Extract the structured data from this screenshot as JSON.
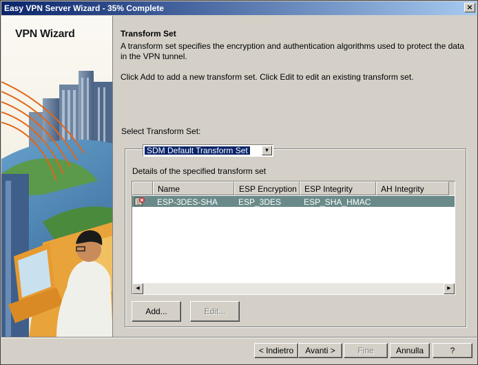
{
  "window": {
    "title": "Easy VPN Server Wizard - 35% Complete",
    "close_label": "×"
  },
  "sidebar": {
    "wizard_title": "VPN Wizard"
  },
  "main": {
    "section_title": "Transform Set",
    "description": "A transform set specifies the encryption and authentication algorithms used to protect the data in the VPN tunnel.",
    "hint": "Click Add to add a new transform set. Click Edit to edit an existing transform set.",
    "select_label": "Select Transform Set:",
    "selected_transform_set": "SDM Default Transform Set",
    "details_label": "Details of the specified transform set",
    "table": {
      "columns": [
        "Name",
        "ESP Encryption",
        "ESP Integrity",
        "AH Integrity"
      ],
      "rows": [
        {
          "icon": "transform-set-icon",
          "name": "ESP-3DES-SHA",
          "esp_encryption": "ESP_3DES",
          "esp_integrity": "ESP_SHA_HMAC",
          "ah_integrity": ""
        }
      ]
    },
    "add_label": "Add...",
    "edit_label": "Edit..."
  },
  "footer": {
    "back_label": "< Indietro",
    "next_label": "Avanti >",
    "finish_label": "Fine",
    "cancel_label": "Annulla",
    "help_label": "?"
  },
  "colors": {
    "titlebar": "#0a246a",
    "selection": "#0a246a",
    "row_highlight": "#6a8a8a",
    "face": "#d4d0c8"
  }
}
